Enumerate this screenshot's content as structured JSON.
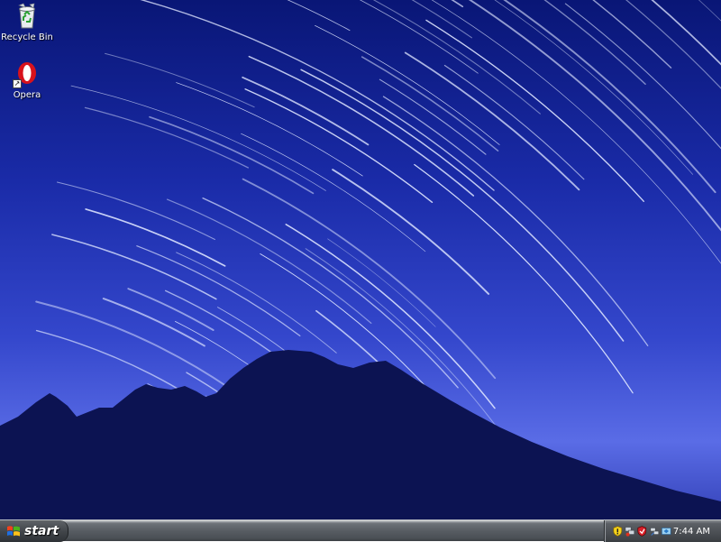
{
  "desktop": {
    "icons": [
      {
        "label": "Recycle Bin",
        "icon": "recycle-bin-icon"
      },
      {
        "label": "Opera",
        "icon": "opera-icon",
        "shortcut": true
      }
    ]
  },
  "taskbar": {
    "start_label": "start",
    "tray_icons": [
      "security-shield-icon",
      "network-icon",
      "antivirus-icon",
      "connection-icon",
      "sync-icon"
    ],
    "clock": "7:44 AM"
  },
  "colors": {
    "sky_top": "#0a1a7a",
    "sky_bottom": "#5a6ee8",
    "mountain": "#0b1250",
    "taskbar": "#585d63"
  }
}
